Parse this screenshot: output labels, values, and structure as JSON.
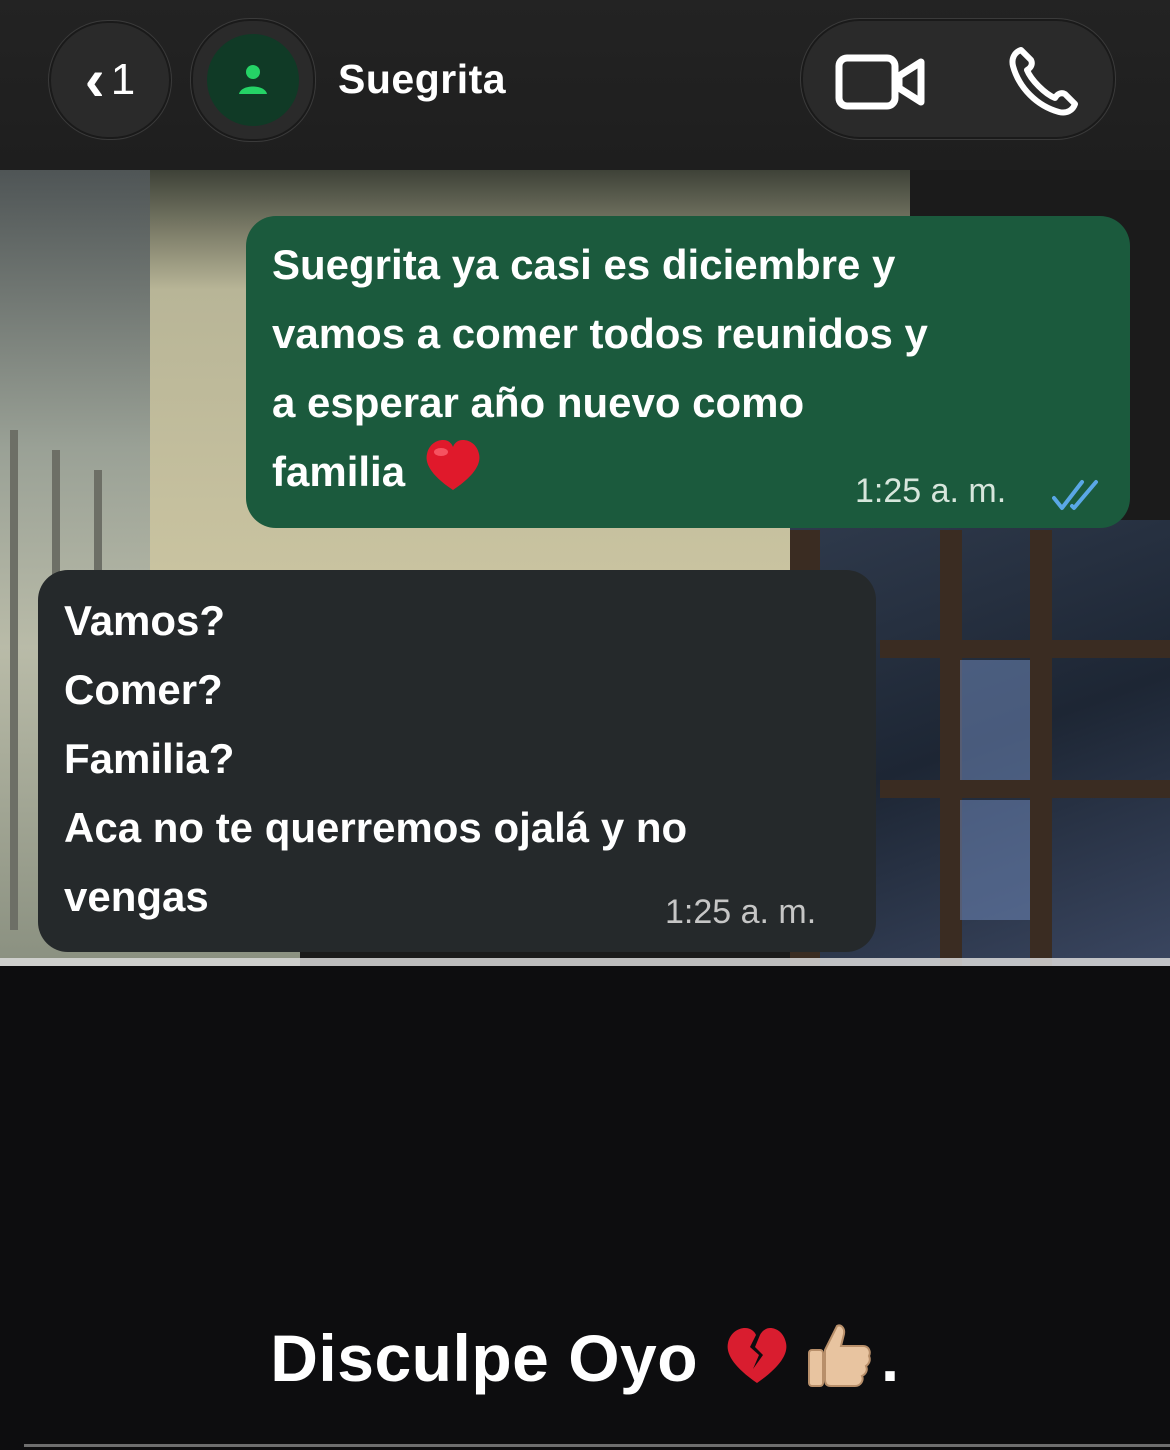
{
  "header": {
    "back_count": "1",
    "contact_name": "Suegrita"
  },
  "messages": [
    {
      "direction": "outgoing",
      "lines": [
        "Suegrita ya casi es diciembre y",
        "vamos a comer todos reunidos y",
        "a esperar año nuevo como",
        "familia"
      ],
      "emoji": "red-heart",
      "time": "1:25 a. m.",
      "status": "read"
    },
    {
      "direction": "incoming",
      "lines": [
        "Vamos?",
        "Comer?",
        "Familia?",
        "Aca no te querremos ojalá y no",
        "vengas"
      ],
      "time": "1:25 a. m."
    }
  ],
  "caption": {
    "text": "Disculpe Oyo",
    "trailing": "."
  },
  "colors": {
    "outgoing_bubble": "#1b5a3d",
    "incoming_bubble": "#25292b",
    "read_ticks": "#5aa7e6",
    "avatar_green": "#25d366"
  }
}
